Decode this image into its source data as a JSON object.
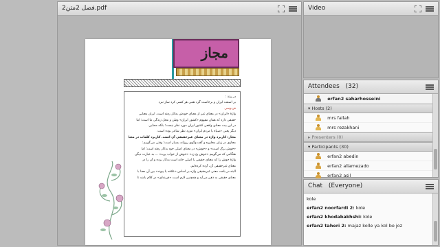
{
  "share": {
    "title": "2فصل 2متن.pdf"
  },
  "document": {
    "page_title": "مجاز",
    "lines": [
      {
        "text": "در پیتة :",
        "style": "normal"
      },
      {
        "text": "بر اسفت ایران و برخاست گرد       همی هر کسی کرد ساز نبرد",
        "style": "normal"
      },
      {
        "text": "فردوسی",
        "style": "red"
      },
      {
        "text": "واژهٔ «ایران» در معنای غیر از معنای خودش به‌کار رفته است. ایران معنایی",
        "style": "normal"
      },
      {
        "text": "حقیقی دارد که همان مفهوم «کشور ایران» وطن و محل زندگی ما است؛ اما",
        "style": "normal"
      },
      {
        "text": "در این بیت معنای واقعی کشور ایران مورد نظر نیست؛ بلکه معنایی",
        "style": "normal"
      },
      {
        "text": "دیگر یعنی «سپاه یا مردم ایران» مورد نظر شاعر بوده است.",
        "style": "normal"
      },
      {
        "text": "مجاز: کاربرد واژه در معنای غیرحقیقی آن است. کاربرد کلمات در معنای",
        "style": "bold"
      },
      {
        "text": "مجازی در زبان محاوره و گفت‌وگوی روزانه بسیار است؛ وقتی می‌گوییم:",
        "style": "normal"
      },
      {
        "text": "«خوش برگ است» و «خوش» در معنای اصلی خود به‌کار رفته است؛ اما",
        "style": "normal"
      },
      {
        "text": "هنگامی که می‌گوییم «خوش پخ زد» «خوش از خواب پرید» ... به عبارت دیگر،",
        "style": "normal"
      },
      {
        "text": "واژهٔ خوش را که معنای حقیقی یا اصلی خانه است به‌کار برده و آن را در",
        "style": "normal"
      },
      {
        "text": "معنای غیرحقیقی آن، آرده کرده‌ایم.",
        "style": "normal"
      },
      {
        "text": "البته در یافت معنی غیرحقیقی واژه بر اساس «علاقه یا پیوند» بین آن معنا با",
        "style": "normal"
      },
      {
        "text": "معنای حقیقی به ذهن می‌آید و همچنین لازم است «قرینه‌ای» در کلام باشد تا",
        "style": "normal"
      }
    ]
  },
  "video": {
    "title": "Video"
  },
  "attendees": {
    "title": "Attendees",
    "count": "(32)",
    "me": "erfan2 saharhosseini",
    "hosts_label": "Hosts (2)",
    "hosts": [
      "mrs fallah",
      "mrs rezakhani"
    ],
    "presenters_label": "Presenters (0)",
    "participants_label": "Participants (30)",
    "participants": [
      "erfan2 abedin",
      "erfan2 allamezado",
      "erfan2 asil"
    ]
  },
  "chat": {
    "title": "Chat",
    "scope": "(Everyone)",
    "messages": [
      {
        "author": "",
        "text": "kole"
      },
      {
        "author": "erfan2 noorfardi 2:",
        "text": "kole"
      },
      {
        "author": "erfan2 khodabakhshi:",
        "text": "kole"
      },
      {
        "author": "erfan2 taheri 2:",
        "text": "majaz kolle ya kol be joz"
      }
    ]
  },
  "colors": {
    "accent_plate": "#c65fa8",
    "teal": "#2a9aa0",
    "red_text": "#c0392b"
  },
  "icons": [
    "fullscreen-icon",
    "menu-icon",
    "person-icon",
    "host-icon"
  ]
}
